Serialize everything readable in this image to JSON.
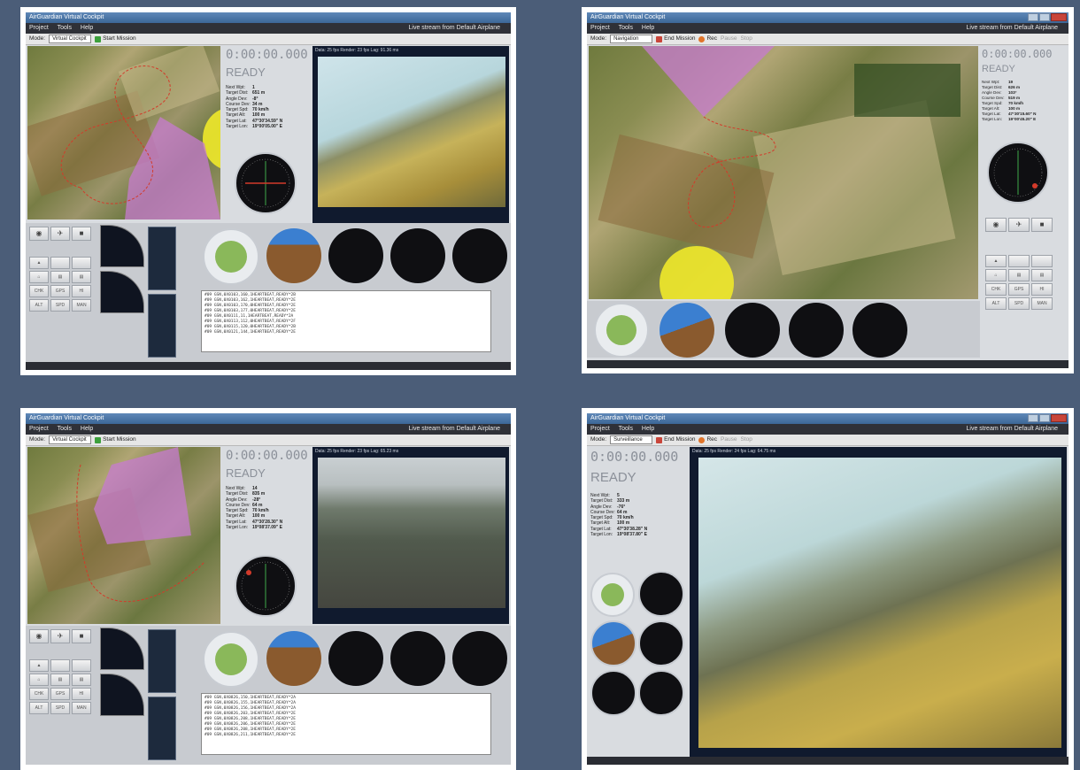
{
  "app": {
    "window_title": "AirGuardian Virtual Cockpit",
    "menu": [
      "Project",
      "Tools",
      "Help"
    ],
    "stream_label": "Live stream from Default Airplane",
    "mode_label": "Mode:",
    "start_mission": "Start Mission",
    "end_mission": "End Mission",
    "rec": "Rec",
    "pause": "Pause",
    "stop": "Stop"
  },
  "stat_keys": [
    "Next Wpt:",
    "Target Dist:",
    "Angle Dev:",
    "Course Dev:",
    "Target Spd:",
    "Target Alt:",
    "Target Lat:",
    "Target Lon:"
  ],
  "button_labels": [
    "CHK",
    "GPS",
    "HI",
    "ALT",
    "SPD",
    "MAN"
  ],
  "panels": [
    {
      "mode": "Virtual Cockpit",
      "timer": "0:00:00.000",
      "status": "READY",
      "video_info": "Data: 25 fps   Render: 23 fps   Lag: 91.36 ms",
      "stats": [
        "1",
        "651 m",
        "-8°",
        "34 m",
        "70 km/h",
        "100 m",
        "47°30'34.59\" N",
        "19°00'05.00\" E"
      ],
      "console": [
        "#09 GSN,0X0103,160,1HEARTBEAT,READY*2B",
        "#09 GSN,0X0103,162,1HEARTBEAT,READY*2E",
        "#09 GSN,0X0103,170,0HEARTBEAT,READY*2E",
        "#09 GSN,0X0103,177,0HEARTBEAT,READY*2E",
        "#09 GSN,0X0111,11,1HEARTBEAT,READY*2A",
        "#09 GSN,0X0113,112,0HEARTBEAT,READY*2F",
        "#09 GSN,0X0115,120,0HEARTBEAT,READY*2B",
        "#09 GSN,0X0121,144,1HEARTBEAT,READY*2E"
      ]
    },
    {
      "mode": "Navigation",
      "timer": "0:00:00.000",
      "status": "READY",
      "stats": [
        "19",
        "626 m",
        "103°",
        "519 m",
        "70 km/h",
        "100 m",
        "47°30'15.60\" N",
        "19°00'45.20\" E"
      ]
    },
    {
      "mode": "Virtual Cockpit",
      "timer": "0:00:00.000",
      "status": "READY",
      "video_info": "Data: 25 fps   Render: 23 fps   Lag: 65.23 ms",
      "stats": [
        "14",
        "835 m",
        "-28°",
        "64 m",
        "70 km/h",
        "100 m",
        "47°30'28.30\" N",
        "19°08'37.09\" E"
      ],
      "console": [
        "#09 GSN,0X0826,150,1HEARTBEAT,READY*2A",
        "#09 GSN,0X0826,155,1HEARTBEAT,READY*2A",
        "#09 GSN,0X0826,156,1HEARTBEAT,READY*2A",
        "#09 GSN,0X0826,203,1HEARTBEAT,READY*2E",
        "#09 GSN,0X0826,208,1HEARTBEAT,READY*2E",
        "#09 GSN,0X0826,206,1HEARTBEAT,READY*2E",
        "#09 GSN,0X0826,208,1HEARTBEAT,READY*2E",
        "#09 GSN,0X0826,211,1HEARTBEAT,READY*2E"
      ]
    },
    {
      "mode": "Surveillance",
      "timer": "0:00:00.000",
      "status": "READY",
      "video_info": "Data: 25 fps   Render: 24 fps   Lag: 64.75 ms",
      "stats": [
        "5",
        "333 m",
        "-76°",
        "64 m",
        "70 km/h",
        "100 m",
        "47°30'38.28\" N",
        "19°08'37.80\" E"
      ]
    }
  ],
  "colors": {
    "background": "#4b5d78",
    "timer_gray": "#8b9099",
    "zone_magenta": "#c77bd0",
    "zone_yellow": "#f0e92a",
    "track_red": "#d33a2a",
    "gauge_bezel": "#c8ccd2"
  },
  "icons": [
    "globe-icon",
    "plane-icon",
    "camera-icon",
    "home-icon",
    "printer-icon",
    "lock-icon"
  ]
}
